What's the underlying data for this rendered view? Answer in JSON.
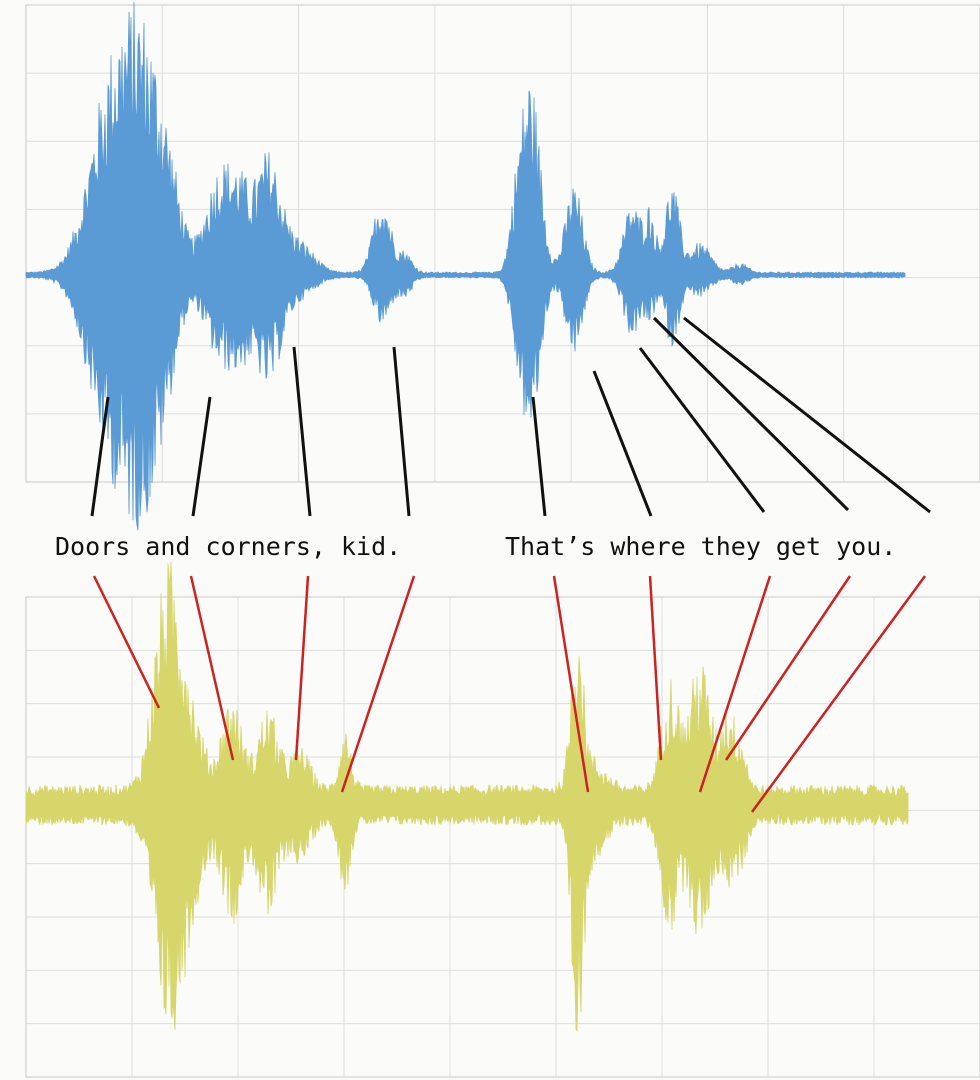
{
  "caption": {
    "phrase_1": "Doors and corners, kid.",
    "phrase_2": "That’s where they get you."
  },
  "words": [
    "Doors",
    "and",
    "corners,",
    "kid.",
    "That’s",
    "where",
    "they",
    "get",
    "you."
  ],
  "colors": {
    "top_waveform": "#5b9bd5",
    "bottom_waveform": "#d6d66a",
    "top_connectors": "#111111",
    "bottom_connectors": "#cc2222",
    "grid": "#dcdcdc",
    "panel_border": "#c8c8c8"
  },
  "panels": [
    {
      "name": "top-waveform",
      "grid_columns": 7,
      "grid_rows": 7,
      "color_key": "top_waveform"
    },
    {
      "name": "bottom-waveform",
      "grid_columns": 9,
      "grid_rows": 9,
      "color_key": "bottom_waveform"
    }
  ]
}
